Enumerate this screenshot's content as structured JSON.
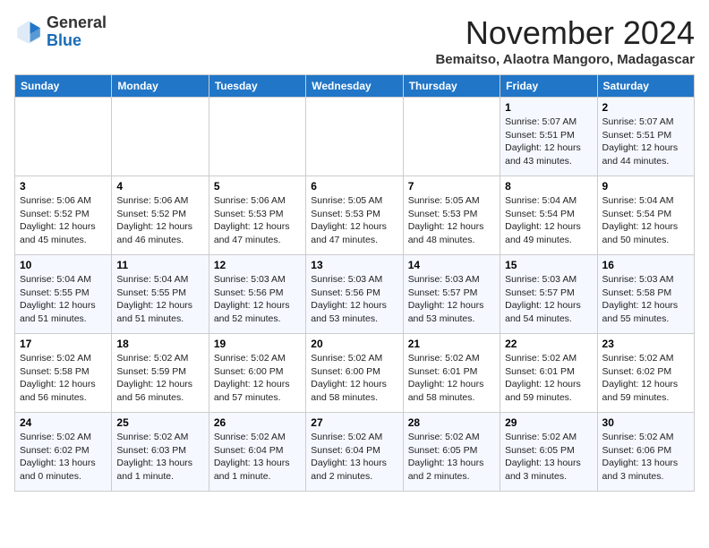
{
  "header": {
    "logo_line1": "General",
    "logo_line2": "Blue",
    "month_title": "November 2024",
    "location": "Bemaitso, Alaotra Mangoro, Madagascar"
  },
  "weekdays": [
    "Sunday",
    "Monday",
    "Tuesday",
    "Wednesday",
    "Thursday",
    "Friday",
    "Saturday"
  ],
  "weeks": [
    [
      {
        "day": "",
        "info": ""
      },
      {
        "day": "",
        "info": ""
      },
      {
        "day": "",
        "info": ""
      },
      {
        "day": "",
        "info": ""
      },
      {
        "day": "",
        "info": ""
      },
      {
        "day": "1",
        "info": "Sunrise: 5:07 AM\nSunset: 5:51 PM\nDaylight: 12 hours\nand 43 minutes."
      },
      {
        "day": "2",
        "info": "Sunrise: 5:07 AM\nSunset: 5:51 PM\nDaylight: 12 hours\nand 44 minutes."
      }
    ],
    [
      {
        "day": "3",
        "info": "Sunrise: 5:06 AM\nSunset: 5:52 PM\nDaylight: 12 hours\nand 45 minutes."
      },
      {
        "day": "4",
        "info": "Sunrise: 5:06 AM\nSunset: 5:52 PM\nDaylight: 12 hours\nand 46 minutes."
      },
      {
        "day": "5",
        "info": "Sunrise: 5:06 AM\nSunset: 5:53 PM\nDaylight: 12 hours\nand 47 minutes."
      },
      {
        "day": "6",
        "info": "Sunrise: 5:05 AM\nSunset: 5:53 PM\nDaylight: 12 hours\nand 47 minutes."
      },
      {
        "day": "7",
        "info": "Sunrise: 5:05 AM\nSunset: 5:53 PM\nDaylight: 12 hours\nand 48 minutes."
      },
      {
        "day": "8",
        "info": "Sunrise: 5:04 AM\nSunset: 5:54 PM\nDaylight: 12 hours\nand 49 minutes."
      },
      {
        "day": "9",
        "info": "Sunrise: 5:04 AM\nSunset: 5:54 PM\nDaylight: 12 hours\nand 50 minutes."
      }
    ],
    [
      {
        "day": "10",
        "info": "Sunrise: 5:04 AM\nSunset: 5:55 PM\nDaylight: 12 hours\nand 51 minutes."
      },
      {
        "day": "11",
        "info": "Sunrise: 5:04 AM\nSunset: 5:55 PM\nDaylight: 12 hours\nand 51 minutes."
      },
      {
        "day": "12",
        "info": "Sunrise: 5:03 AM\nSunset: 5:56 PM\nDaylight: 12 hours\nand 52 minutes."
      },
      {
        "day": "13",
        "info": "Sunrise: 5:03 AM\nSunset: 5:56 PM\nDaylight: 12 hours\nand 53 minutes."
      },
      {
        "day": "14",
        "info": "Sunrise: 5:03 AM\nSunset: 5:57 PM\nDaylight: 12 hours\nand 53 minutes."
      },
      {
        "day": "15",
        "info": "Sunrise: 5:03 AM\nSunset: 5:57 PM\nDaylight: 12 hours\nand 54 minutes."
      },
      {
        "day": "16",
        "info": "Sunrise: 5:03 AM\nSunset: 5:58 PM\nDaylight: 12 hours\nand 55 minutes."
      }
    ],
    [
      {
        "day": "17",
        "info": "Sunrise: 5:02 AM\nSunset: 5:58 PM\nDaylight: 12 hours\nand 56 minutes."
      },
      {
        "day": "18",
        "info": "Sunrise: 5:02 AM\nSunset: 5:59 PM\nDaylight: 12 hours\nand 56 minutes."
      },
      {
        "day": "19",
        "info": "Sunrise: 5:02 AM\nSunset: 6:00 PM\nDaylight: 12 hours\nand 57 minutes."
      },
      {
        "day": "20",
        "info": "Sunrise: 5:02 AM\nSunset: 6:00 PM\nDaylight: 12 hours\nand 58 minutes."
      },
      {
        "day": "21",
        "info": "Sunrise: 5:02 AM\nSunset: 6:01 PM\nDaylight: 12 hours\nand 58 minutes."
      },
      {
        "day": "22",
        "info": "Sunrise: 5:02 AM\nSunset: 6:01 PM\nDaylight: 12 hours\nand 59 minutes."
      },
      {
        "day": "23",
        "info": "Sunrise: 5:02 AM\nSunset: 6:02 PM\nDaylight: 12 hours\nand 59 minutes."
      }
    ],
    [
      {
        "day": "24",
        "info": "Sunrise: 5:02 AM\nSunset: 6:02 PM\nDaylight: 13 hours\nand 0 minutes."
      },
      {
        "day": "25",
        "info": "Sunrise: 5:02 AM\nSunset: 6:03 PM\nDaylight: 13 hours\nand 1 minute."
      },
      {
        "day": "26",
        "info": "Sunrise: 5:02 AM\nSunset: 6:04 PM\nDaylight: 13 hours\nand 1 minute."
      },
      {
        "day": "27",
        "info": "Sunrise: 5:02 AM\nSunset: 6:04 PM\nDaylight: 13 hours\nand 2 minutes."
      },
      {
        "day": "28",
        "info": "Sunrise: 5:02 AM\nSunset: 6:05 PM\nDaylight: 13 hours\nand 2 minutes."
      },
      {
        "day": "29",
        "info": "Sunrise: 5:02 AM\nSunset: 6:05 PM\nDaylight: 13 hours\nand 3 minutes."
      },
      {
        "day": "30",
        "info": "Sunrise: 5:02 AM\nSunset: 6:06 PM\nDaylight: 13 hours\nand 3 minutes."
      }
    ]
  ]
}
